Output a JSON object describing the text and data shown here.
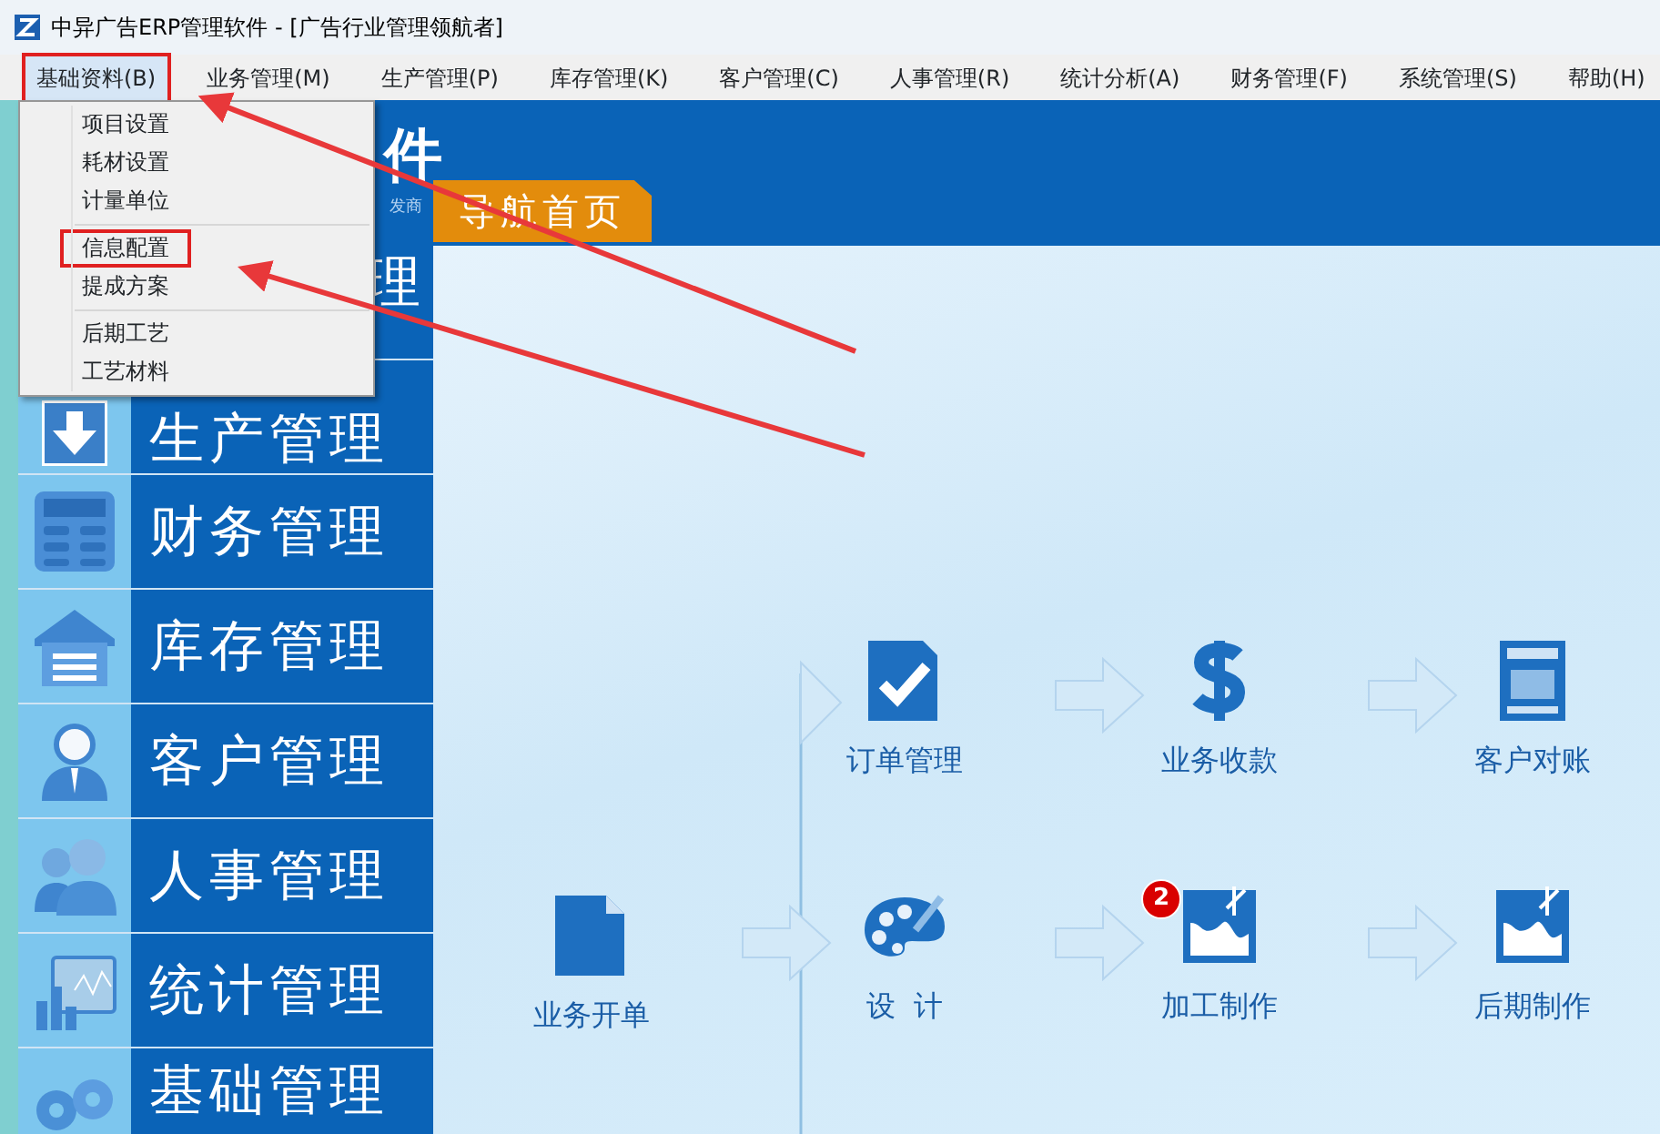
{
  "window": {
    "title": "中异广告ERP管理软件 - [广告行业管理领航者]"
  },
  "menu": [
    {
      "label": "基础资料(B)",
      "selected": true,
      "highlighted": true
    },
    {
      "label": "业务管理(M)",
      "selected": false,
      "highlighted": false
    },
    {
      "label": "生产管理(P)",
      "selected": false,
      "highlighted": false
    },
    {
      "label": "库存管理(K)",
      "selected": false,
      "highlighted": false
    },
    {
      "label": "客户管理(C)",
      "selected": false,
      "highlighted": false
    },
    {
      "label": "人事管理(R)",
      "selected": false,
      "highlighted": false
    },
    {
      "label": "统计分析(A)",
      "selected": false,
      "highlighted": false
    },
    {
      "label": "财务管理(F)",
      "selected": false,
      "highlighted": false
    },
    {
      "label": "系统管理(S)",
      "selected": false,
      "highlighted": false
    },
    {
      "label": "帮助(H)",
      "selected": false,
      "highlighted": false
    }
  ],
  "dropdown": {
    "groups": [
      [
        {
          "label": "项目设置",
          "highlighted": false
        },
        {
          "label": "耗材设置",
          "highlighted": false
        },
        {
          "label": "计量单位",
          "highlighted": false
        }
      ],
      [
        {
          "label": "信息配置",
          "highlighted": true
        },
        {
          "label": "提成方案",
          "highlighted": false
        }
      ],
      [
        {
          "label": "后期工艺",
          "highlighted": false
        },
        {
          "label": "工艺材料",
          "highlighted": false
        }
      ]
    ]
  },
  "header": {
    "title": "件",
    "subtitle": "发商",
    "tab": "导航首页"
  },
  "sidebar": {
    "items": [
      {
        "label": "理",
        "kind": "blank"
      },
      {
        "label": "生产管理",
        "kind": "download"
      },
      {
        "label": "财务管理",
        "kind": "calculator"
      },
      {
        "label": "库存管理",
        "kind": "warehouse"
      },
      {
        "label": "客户管理",
        "kind": "person"
      },
      {
        "label": "人事管理",
        "kind": "people"
      },
      {
        "label": "统计管理",
        "kind": "chart"
      },
      {
        "label": "基础管理",
        "kind": "gears"
      }
    ]
  },
  "flow": {
    "nodes": [
      {
        "label": "业务开单",
        "kind": "new"
      },
      {
        "label": "订单管理",
        "kind": "check"
      },
      {
        "label": "业务收款",
        "kind": "dollar"
      },
      {
        "label": "客户对账",
        "kind": "statement"
      },
      {
        "label": "设  计",
        "kind": "palette"
      },
      {
        "label": "加工制作",
        "kind": "image",
        "badge": "2"
      },
      {
        "label": "后期制作",
        "kind": "image"
      }
    ]
  }
}
